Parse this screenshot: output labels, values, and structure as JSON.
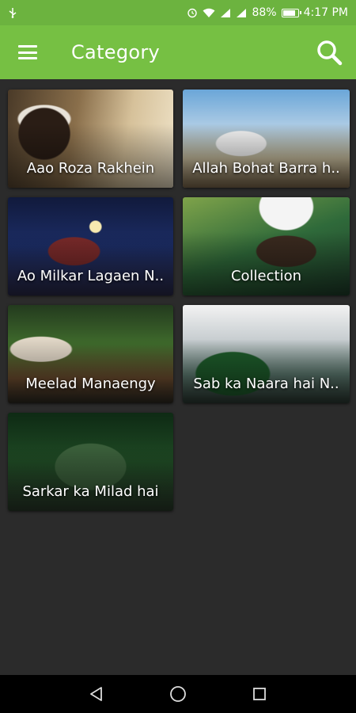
{
  "status_bar": {
    "battery": "88%",
    "battery_level": 0.88,
    "time": "4:17 PM",
    "icons": [
      "usb-icon",
      "alarm-icon",
      "wifi-icon",
      "signal-icon",
      "signal-icon",
      "battery-icon"
    ]
  },
  "app_bar": {
    "title": "Category",
    "background": "#76c043"
  },
  "categories": [
    {
      "label": "Aao Roza Rakhein"
    },
    {
      "label": "Allah Bohat Barra h.."
    },
    {
      "label": "Ao Milkar Lagaen N.."
    },
    {
      "label": "Collection"
    },
    {
      "label": "Meelad Manaengy"
    },
    {
      "label": "Sab ka Naara hai N.."
    },
    {
      "label": "Sarkar ka Milad hai"
    }
  ],
  "nav_bar": {
    "icons": [
      "back-icon",
      "home-icon",
      "recents-icon"
    ]
  }
}
